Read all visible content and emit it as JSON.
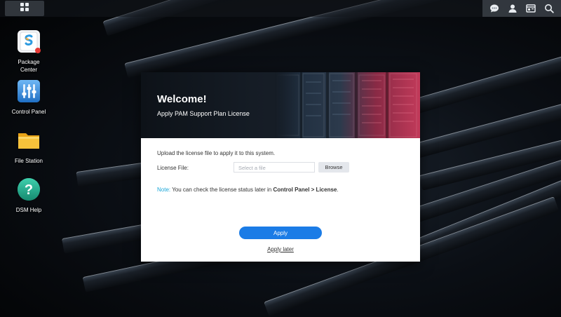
{
  "desktop": {
    "icons": [
      {
        "label_line1": "Package",
        "label_line2": "Center",
        "icon": "package-center-icon"
      },
      {
        "label_line1": "Control Panel",
        "label_line2": "",
        "icon": "control-panel-icon"
      },
      {
        "label_line1": "File Station",
        "label_line2": "",
        "icon": "file-station-icon"
      },
      {
        "label_line1": "DSM Help",
        "label_line2": "",
        "icon": "dsm-help-icon"
      }
    ]
  },
  "taskbar": {
    "main_menu_icon": "grid-icon",
    "tray_icons": [
      "chat-icon",
      "user-icon",
      "widgets-icon",
      "search-icon"
    ]
  },
  "dialog": {
    "title": "Welcome!",
    "subtitle": "Apply PAM Support Plan License",
    "intro": "Upload the license file to apply it to this system.",
    "file_label": "License File:",
    "file_placeholder": "Select a file",
    "browse_label": "Browse",
    "note_key": "Note:",
    "note_text": " You can check the license status later in ",
    "note_path": "Control Panel > License",
    "note_end": ".",
    "apply_label": "Apply",
    "apply_later_label": "Apply later"
  },
  "colors": {
    "accent": "#1b7ce6",
    "note": "#1aa6d8"
  }
}
